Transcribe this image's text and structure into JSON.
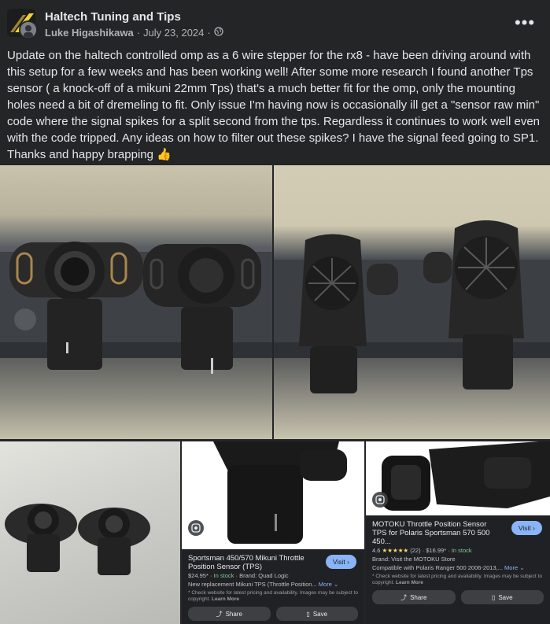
{
  "post": {
    "group_name": "Haltech Tuning and Tips",
    "author": "Luke Higashikawa",
    "separator": "·",
    "date": "July 23, 2024",
    "text": "Update on the haltech controlled omp as a 6 wire stepper for the rx8 - have been driving around with this setup for a few weeks and has been working well! After some more research I found another Tps sensor ( a knock-off of a mikuni 22mm Tps) that's a much better fit for the omp, only the mounting holes need a bit of dremeling to fit. Only issue I'm having now is occasionally ill get a \"sensor raw min\" code where the signal spikes for a split second from the tps. Regardless it continues to work well even with the code tripped. Any ideas on how to filter out these spikes? I have the signal feed going to SP1. Thanks and happy brapping 👍",
    "more_label": "•••"
  },
  "cards": [
    {
      "title": "Sportsman 450/570 Mikuni Throttle Position Sensor (TPS)",
      "price": "$24.95*",
      "stock": "In stock",
      "brand": "Brand: Quad Logic",
      "desc": "New replacement Mikuni TPS (Throttle Position...",
      "more": "More",
      "fine": "* Check website for latest pricing and availability. Images may be subject to copyright.",
      "learn": "Learn More",
      "visit": "Visit",
      "share": "Share",
      "save": "Save"
    },
    {
      "title": "MOTOKU Throttle Position Sensor TPS for Polaris Sportsman 570 500 450...",
      "rating": "4.6",
      "stars": "★★★★★",
      "reviews": "(22)",
      "price": "$16.99*",
      "stock": "In stock",
      "brand": "Brand: Visit the MOTOKU Store",
      "desc": "Compatible with Polaris Ranger 500 2006-2013,...",
      "more": "More",
      "fine": "* Check website for latest pricing and availability. Images may be subject to copyright.",
      "learn": "Learn More",
      "visit": "Visit",
      "share": "Share",
      "save": "Save"
    }
  ],
  "colors": {
    "background": "#242526",
    "text": "#e4e6eb",
    "secondary_text": "#b0b3b8",
    "visit_button": "#8ab4f8",
    "in_stock": "#81c995"
  }
}
